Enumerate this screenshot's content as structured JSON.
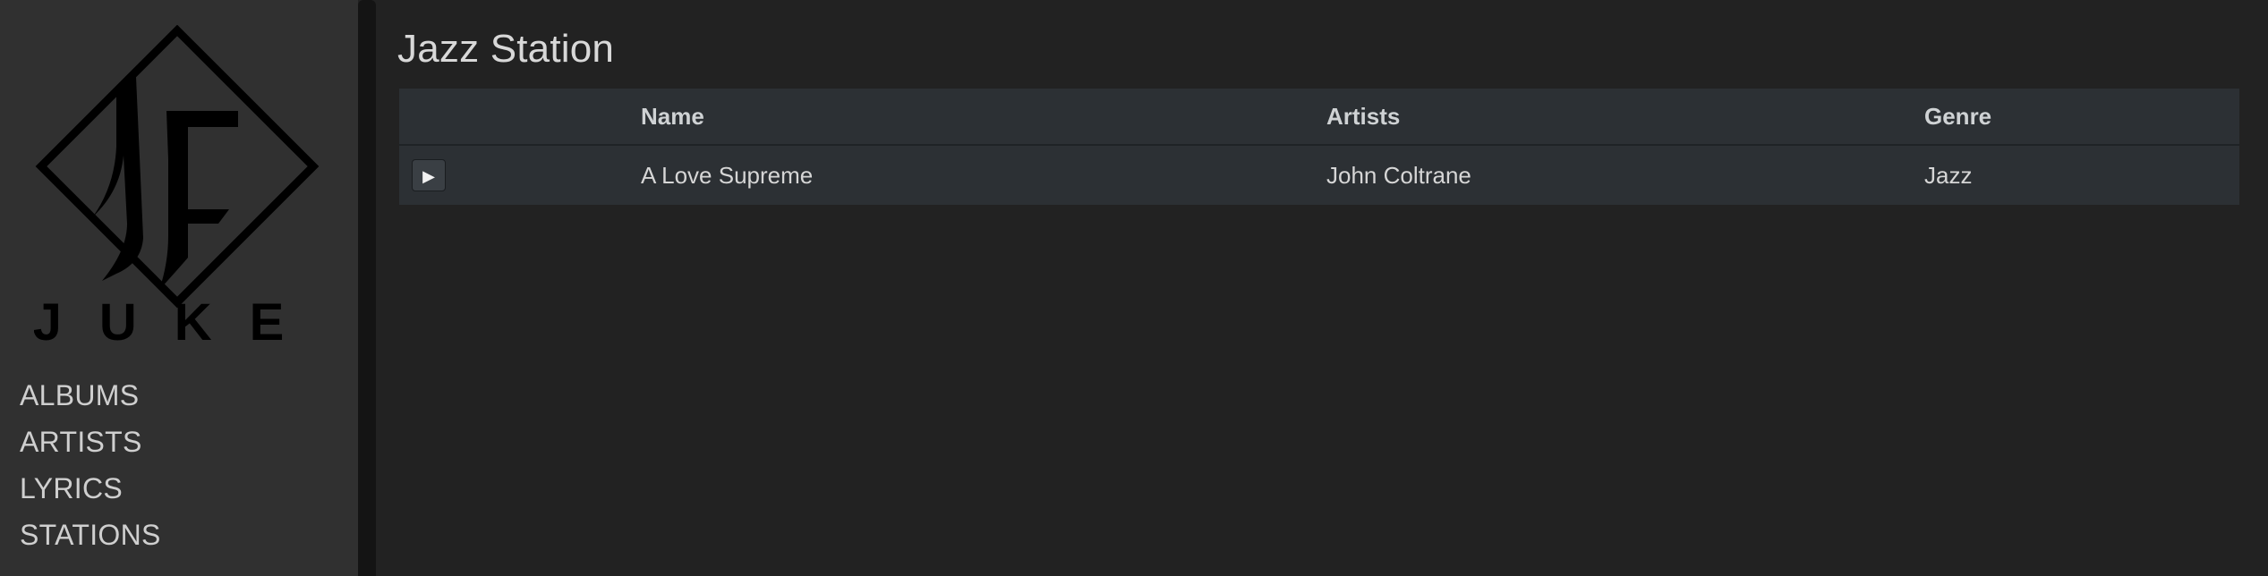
{
  "sidebar": {
    "logo_text": "JUKE",
    "nav": [
      {
        "label": "ALBUMS"
      },
      {
        "label": "ARTISTS"
      },
      {
        "label": "LYRICS"
      },
      {
        "label": "STATIONS"
      }
    ]
  },
  "main": {
    "title": "Jazz Station",
    "table": {
      "headers": {
        "play": "",
        "name": "Name",
        "artists": "Artists",
        "genre": "Genre"
      },
      "rows": [
        {
          "play_icon": "play-icon",
          "play_glyph": "▶",
          "name": "A Love Supreme",
          "artists": "John Coltrane",
          "genre": "Jazz"
        }
      ]
    }
  },
  "colors": {
    "background": "#222222",
    "sidebar": "#303030",
    "table_bg": "#2c3034",
    "text": "#d6d6d6",
    "logo": "#000000"
  }
}
